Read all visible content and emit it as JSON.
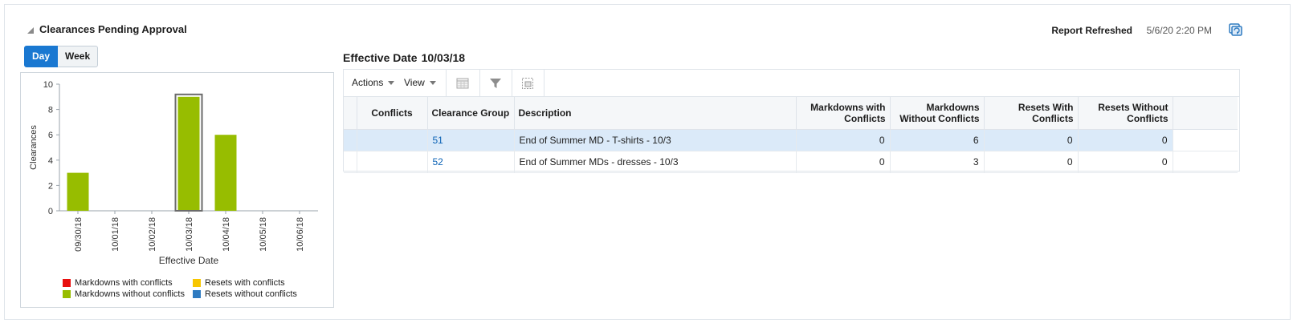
{
  "panel": {
    "title": "Clearances Pending Approval",
    "refresh_label": "Report Refreshed",
    "refresh_value": "5/6/20 2:20 PM"
  },
  "toggle": {
    "day_label": "Day",
    "week_label": "Week",
    "selected": "Day"
  },
  "chart_data": {
    "type": "bar",
    "categories": [
      "09/30/18",
      "10/01/18",
      "10/02/18",
      "10/03/18",
      "10/04/18",
      "10/05/18",
      "10/06/18"
    ],
    "series": [
      {
        "name": "Markdowns with conflicts",
        "values": [
          0,
          0,
          0,
          0,
          0,
          0,
          0
        ],
        "color": "#e8100f"
      },
      {
        "name": "Markdowns without conflicts",
        "values": [
          3,
          0,
          0,
          9,
          6,
          0,
          0
        ],
        "color": "#97bd00"
      },
      {
        "name": "Resets with conflicts",
        "values": [
          0,
          0,
          0,
          0,
          0,
          0,
          0
        ],
        "color": "#f7c600"
      },
      {
        "name": "Resets without conflicts",
        "values": [
          0,
          0,
          0,
          0,
          0,
          0,
          0
        ],
        "color": "#2f7bc1"
      }
    ],
    "xlabel": "Effective Date",
    "ylabel": "Clearances",
    "ylim": [
      0,
      10
    ],
    "yticks": [
      "0",
      "2",
      "4",
      "6",
      "8",
      "10"
    ],
    "selected_category": "10/03/18",
    "grid": false,
    "legend_position": "bottom"
  },
  "effective_date": {
    "label": "Effective Date",
    "value": "10/03/18"
  },
  "toolbar": {
    "actions_label": "Actions",
    "view_label": "View"
  },
  "table": {
    "headers": {
      "conflicts": "Conflicts",
      "clearance_group": "Clearance Group",
      "description": "Description",
      "md_with_1": "Markdowns with",
      "md_with_2": "Conflicts",
      "md_without_1": "Markdowns",
      "md_without_2": "Without Conflicts",
      "rs_with_1": "Resets With",
      "rs_with_2": "Conflicts",
      "rs_without_1": "Resets Without",
      "rs_without_2": "Conflicts"
    },
    "rows": [
      {
        "conflicts": "",
        "group": "51",
        "description": "End of Summer MD - T-shirts - 10/3",
        "md_with": "0",
        "md_without": "6",
        "rs_with": "0",
        "rs_without": "0"
      },
      {
        "conflicts": "",
        "group": "52",
        "description": "End of Summer MDs - dresses - 10/3",
        "md_with": "0",
        "md_without": "3",
        "rs_with": "0",
        "rs_without": "0"
      }
    ]
  }
}
